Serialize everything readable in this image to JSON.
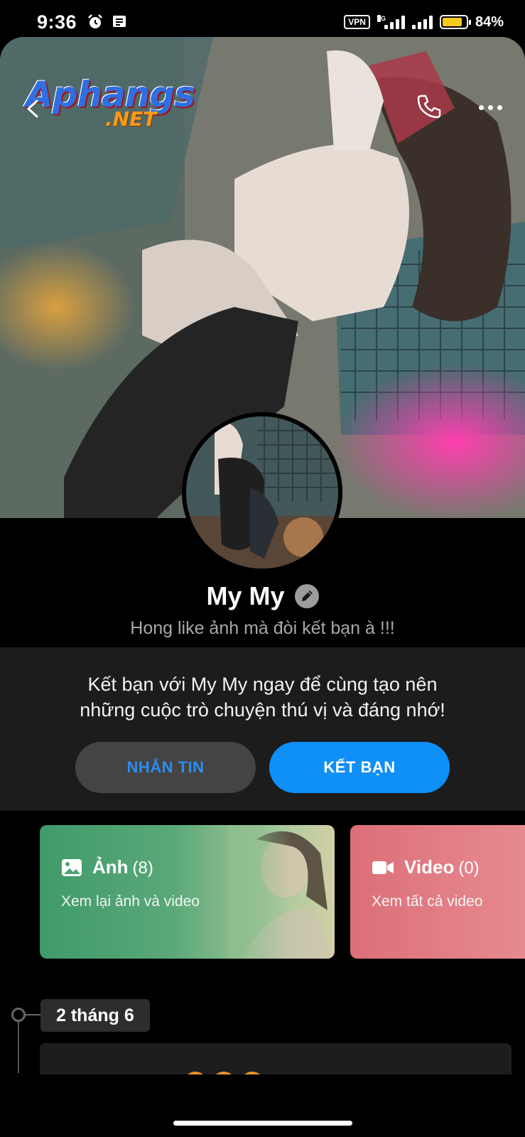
{
  "status_bar": {
    "time": "9:36",
    "vpn": "VPN",
    "network": "4G",
    "battery_text": "84%",
    "battery_level": 0.84
  },
  "header": {
    "logo_main": "Aphangs",
    "logo_sub": ".NET",
    "back_icon": "chevron-left-icon",
    "call_icon": "phone-icon",
    "more_icon": "more-horizontal-icon"
  },
  "profile": {
    "name": "My My",
    "bio": "Hong like ảnh mà đòi kết bạn à !!!"
  },
  "friend_prompt": {
    "message_line1": "Kết bạn với My My ngay để cùng tạo nên",
    "message_line2": "những cuộc trò chuyện thú vị và đáng nhớ!",
    "message_button": "NHẮN TIN",
    "add_friend_button": "KẾT BẠN"
  },
  "media": {
    "photos": {
      "title": "Ảnh",
      "count": "(8)",
      "subtitle": "Xem lại ảnh và video",
      "icon": "image-icon"
    },
    "videos": {
      "title": "Video",
      "count": "(0)",
      "subtitle": "Xem tất cả video",
      "icon": "video-camera-icon"
    }
  },
  "timeline": {
    "date": "2 tháng 6"
  },
  "colors": {
    "accent_blue": "#0f8ff8",
    "message_text_blue": "#2a8ef0",
    "photos_card_green": "#3f9a6a",
    "videos_card_pink": "#dd6f79",
    "battery_yellow": "#f6c91b"
  }
}
